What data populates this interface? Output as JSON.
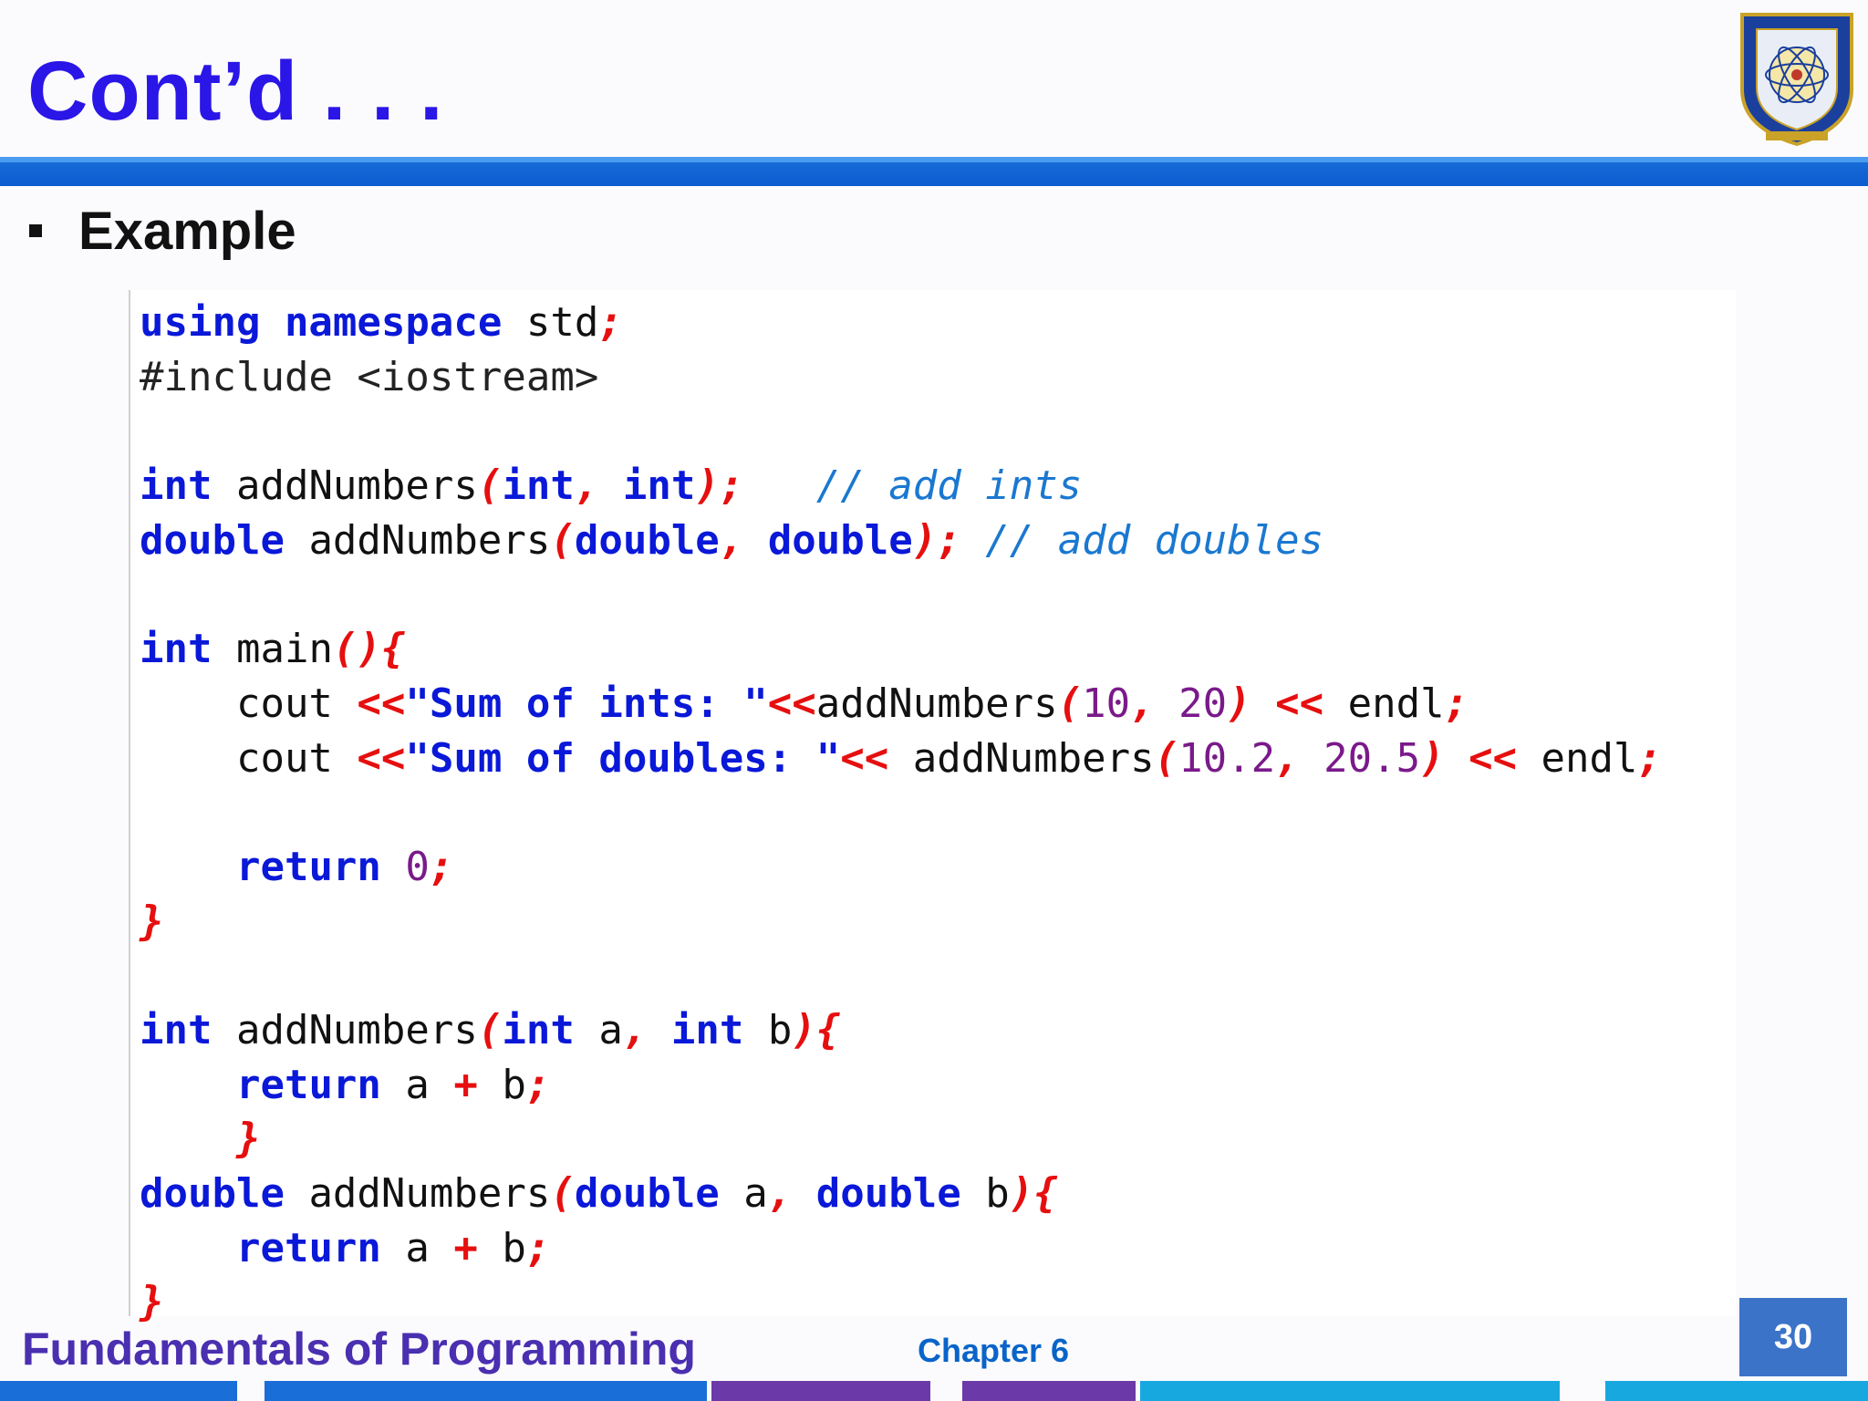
{
  "slide": {
    "title": "Cont’d . . .",
    "bullet": "Example",
    "footer_left": "Fundamentals of Programming",
    "footer_center": "Chapter 6",
    "page_number": "30",
    "logo_icon": "university-seal-icon"
  },
  "code_lines": [
    [
      {
        "t": "using namespace",
        "c": "kw"
      },
      {
        "t": " std",
        "c": ""
      },
      {
        "t": ";",
        "c": "pn"
      }
    ],
    [
      {
        "t": "#include <iostream>",
        "c": "pp"
      }
    ],
    [],
    [
      {
        "t": "int",
        "c": "kw"
      },
      {
        "t": " addNumbers",
        "c": ""
      },
      {
        "t": "(",
        "c": "pn"
      },
      {
        "t": "int",
        "c": "kw"
      },
      {
        "t": ",",
        "c": "pn"
      },
      {
        "t": " ",
        "c": ""
      },
      {
        "t": "int",
        "c": "kw"
      },
      {
        "t": ");",
        "c": "pn"
      },
      {
        "t": "   ",
        "c": ""
      },
      {
        "t": "// add ints",
        "c": "cm"
      }
    ],
    [
      {
        "t": "double",
        "c": "kw"
      },
      {
        "t": " addNumbers",
        "c": ""
      },
      {
        "t": "(",
        "c": "pn"
      },
      {
        "t": "double",
        "c": "kw"
      },
      {
        "t": ",",
        "c": "pn"
      },
      {
        "t": " ",
        "c": ""
      },
      {
        "t": "double",
        "c": "kw"
      },
      {
        "t": ");",
        "c": "pn"
      },
      {
        "t": " ",
        "c": ""
      },
      {
        "t": "// add doubles",
        "c": "cm"
      }
    ],
    [],
    [
      {
        "t": "int",
        "c": "kw"
      },
      {
        "t": " main",
        "c": ""
      },
      {
        "t": "(){",
        "c": "pn"
      }
    ],
    [
      {
        "t": "    cout ",
        "c": ""
      },
      {
        "t": "<<",
        "c": "pn"
      },
      {
        "t": "\"Sum of ints: \"",
        "c": "st"
      },
      {
        "t": "<<",
        "c": "pn"
      },
      {
        "t": "addNumbers",
        "c": ""
      },
      {
        "t": "(",
        "c": "pn"
      },
      {
        "t": "10",
        "c": "nm"
      },
      {
        "t": ",",
        "c": "pn"
      },
      {
        "t": " ",
        "c": ""
      },
      {
        "t": "20",
        "c": "nm"
      },
      {
        "t": ")",
        "c": "pn"
      },
      {
        "t": " ",
        "c": ""
      },
      {
        "t": "<<",
        "c": "pn"
      },
      {
        "t": " endl",
        "c": ""
      },
      {
        "t": ";",
        "c": "pn"
      }
    ],
    [
      {
        "t": "    cout ",
        "c": ""
      },
      {
        "t": "<<",
        "c": "pn"
      },
      {
        "t": "\"Sum of doubles: \"",
        "c": "st"
      },
      {
        "t": "<<",
        "c": "pn"
      },
      {
        "t": " addNumbers",
        "c": ""
      },
      {
        "t": "(",
        "c": "pn"
      },
      {
        "t": "10.2",
        "c": "nm"
      },
      {
        "t": ",",
        "c": "pn"
      },
      {
        "t": " ",
        "c": ""
      },
      {
        "t": "20.5",
        "c": "nm"
      },
      {
        "t": ")",
        "c": "pn"
      },
      {
        "t": " ",
        "c": ""
      },
      {
        "t": "<<",
        "c": "pn"
      },
      {
        "t": " endl",
        "c": ""
      },
      {
        "t": ";",
        "c": "pn"
      }
    ],
    [],
    [
      {
        "t": "    ",
        "c": ""
      },
      {
        "t": "return",
        "c": "kw"
      },
      {
        "t": " ",
        "c": ""
      },
      {
        "t": "0",
        "c": "nm"
      },
      {
        "t": ";",
        "c": "pn"
      }
    ],
    [
      {
        "t": "}",
        "c": "pn"
      }
    ],
    [],
    [
      {
        "t": "int",
        "c": "kw"
      },
      {
        "t": " addNumbers",
        "c": ""
      },
      {
        "t": "(",
        "c": "pn"
      },
      {
        "t": "int",
        "c": "kw"
      },
      {
        "t": " a",
        "c": ""
      },
      {
        "t": ",",
        "c": "pn"
      },
      {
        "t": " ",
        "c": ""
      },
      {
        "t": "int",
        "c": "kw"
      },
      {
        "t": " b",
        "c": ""
      },
      {
        "t": "){",
        "c": "pn"
      }
    ],
    [
      {
        "t": "    ",
        "c": ""
      },
      {
        "t": "return",
        "c": "kw"
      },
      {
        "t": " a ",
        "c": ""
      },
      {
        "t": "+",
        "c": "pn"
      },
      {
        "t": " b",
        "c": ""
      },
      {
        "t": ";",
        "c": "pn"
      }
    ],
    [
      {
        "t": "    ",
        "c": ""
      },
      {
        "t": "}",
        "c": "pn"
      }
    ],
    [
      {
        "t": "double",
        "c": "kw"
      },
      {
        "t": " addNumbers",
        "c": ""
      },
      {
        "t": "(",
        "c": "pn"
      },
      {
        "t": "double",
        "c": "kw"
      },
      {
        "t": " a",
        "c": ""
      },
      {
        "t": ",",
        "c": "pn"
      },
      {
        "t": " ",
        "c": ""
      },
      {
        "t": "double",
        "c": "kw"
      },
      {
        "t": " b",
        "c": ""
      },
      {
        "t": "){",
        "c": "pn"
      }
    ],
    [
      {
        "t": "    ",
        "c": ""
      },
      {
        "t": "return",
        "c": "kw"
      },
      {
        "t": " a ",
        "c": ""
      },
      {
        "t": "+",
        "c": "pn"
      },
      {
        "t": " b",
        "c": ""
      },
      {
        "t": ";",
        "c": "pn"
      }
    ],
    [
      {
        "t": "}",
        "c": "pn"
      }
    ]
  ],
  "colors": {
    "title": "#2a16e6",
    "header_bar": "#0b5cd0",
    "keyword": "#0a18d8",
    "punctuation": "#e60f0f",
    "comment": "#1a78d0",
    "number": "#7a1a8a",
    "footer_left": "#4a2fb0",
    "footer_center": "#0a64c8",
    "page_box": "#3b73c8"
  }
}
